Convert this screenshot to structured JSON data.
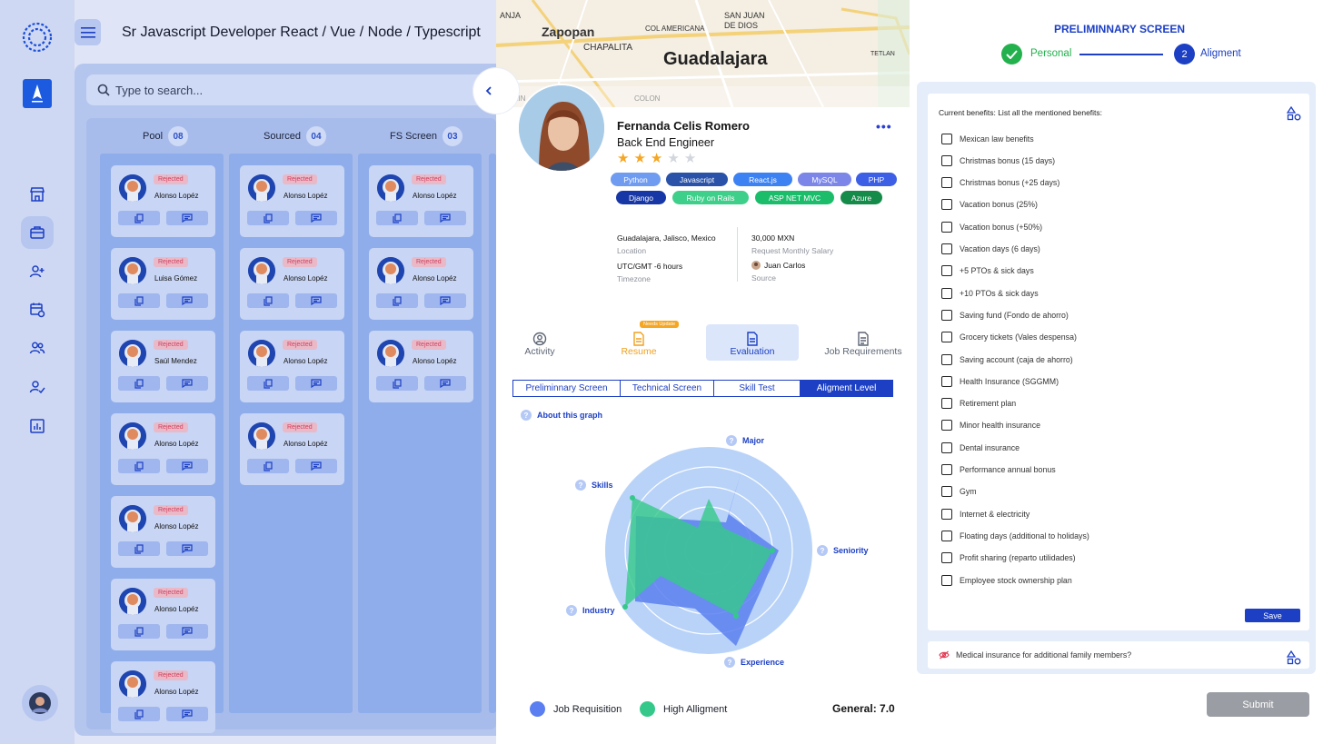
{
  "header": {
    "job_title": "Sr Javascript Developer React / Vue / Node / Typescript"
  },
  "sidebar": {
    "items": [
      {
        "icon": "store-icon",
        "label": ""
      },
      {
        "icon": "briefcase-icon",
        "label": "",
        "active": true
      },
      {
        "icon": "add-user-icon",
        "label": ""
      },
      {
        "icon": "calendar-clock-icon",
        "label": ""
      },
      {
        "icon": "team-icon",
        "label": ""
      },
      {
        "icon": "user-check-icon",
        "label": ""
      },
      {
        "icon": "chart-icon",
        "label": ""
      }
    ]
  },
  "search": {
    "placeholder": "Type to search..."
  },
  "lanes": [
    {
      "name": "Pool",
      "count": "08"
    },
    {
      "name": "Sourced",
      "count": "04"
    },
    {
      "name": "FS Screen",
      "count": "03"
    }
  ],
  "cards": {
    "badge": "Rejected",
    "pool": [
      "Alonso Lopéz",
      "Luisa Gómez",
      "Saúl Mendez",
      "Alonso Lopéz",
      "Alonso Lopéz",
      "Alonso Lopéz",
      "Alonso Lopéz"
    ],
    "sourced": [
      "Alonso Lopéz",
      "Alonso Lopéz",
      "Alonso Lopéz",
      "Alonso Lopéz"
    ],
    "fs": [
      "Alonso Lopéz",
      "Alonso Lopéz",
      "Alonso Lopéz"
    ]
  },
  "map": {
    "city": "Guadalajara",
    "labels": [
      "Zapopan",
      "CHAPALITA",
      "COL AMERICANA",
      "SAN JUAN",
      "DE DIOS",
      "TETLAN",
      "ANJA",
      "COLIN",
      "COLON"
    ]
  },
  "candidate": {
    "name": "Fernanda Celis Romero",
    "role": "Back End Engineer",
    "rating": 3,
    "rating_max": 5,
    "stars": "★★★★★",
    "more": "•••",
    "tags": [
      {
        "label": "Python",
        "color": "#6f9bf0"
      },
      {
        "label": "Javascript",
        "color": "#2952a8"
      },
      {
        "label": "React.js",
        "color": "#3d82f2"
      },
      {
        "label": "MySQL",
        "color": "#7b86e8"
      },
      {
        "label": "PHP",
        "color": "#3c5fe6"
      },
      {
        "label": "Django",
        "color": "#1737a6"
      },
      {
        "label": "Ruby on Rails",
        "color": "#3ecf8a"
      },
      {
        "label": "ASP NET MVC",
        "color": "#1bbd6b"
      },
      {
        "label": "Azure",
        "color": "#158b4a"
      }
    ],
    "location": {
      "value": "Guadalajara, Jalisco, Mexico",
      "label": "Location"
    },
    "timezone": {
      "value": "UTC/GMT -6 hours",
      "label": "Timezone"
    },
    "salary": {
      "value": "30,000 MXN",
      "label": "Request Monthly Salary"
    },
    "source": {
      "value": "Juan Carlos",
      "label": "Source"
    }
  },
  "tabs": [
    {
      "label": "Activity",
      "icon": "activity-icon"
    },
    {
      "label": "Resume",
      "icon": "resume-icon",
      "badge": "Needs Update"
    },
    {
      "label": "Evaluation",
      "icon": "evaluation-icon",
      "active": true
    },
    {
      "label": "Job Requirements",
      "icon": "requirements-icon"
    }
  ],
  "subtabs": [
    "Preliminnary Screen",
    "Technical Screen",
    "Skill Test",
    "Aligment Level"
  ],
  "about_graph": "About this graph",
  "radar": {
    "axes": [
      "Major",
      "Seniority",
      "Experience",
      "Industry",
      "Skills"
    ],
    "series": [
      {
        "name": "Job Requisition",
        "color": "#5b7ff0"
      },
      {
        "name": "High Alligment",
        "color": "#34c98a"
      }
    ]
  },
  "general": "General: 7.0",
  "right": {
    "title": "PRELIMINNARY SCREEN",
    "steps": [
      {
        "num": "",
        "label": "Personal",
        "done": true
      },
      {
        "num": "2",
        "label": "Aligment",
        "done": false
      }
    ],
    "question": "Current benefits: List all the mentioned benefits:",
    "benefits": [
      "Mexican law benefits",
      " Christmas bonus (15 days)",
      "Christmas bonus (+25 days)",
      "Vacation bonus (25%)",
      "Vacation bonus (+50%)",
      "Vacation days (6 days)",
      "+5 PTOs & sick days",
      "+10 PTOs & sick days",
      "Saving fund (Fondo de ahorro)",
      "Grocery tickets (Vales despensa)",
      "Saving account (caja de ahorro)",
      "Health Insurance (SGGMM)",
      "Retirement plan",
      "Minor health insurance",
      "Dental insurance",
      "Performance annual bonus",
      "Gym",
      "Internet & electricity",
      "Floating days (additional to holidays)",
      "Profit sharing (reparto utilidades)",
      "Employee stock ownership plan"
    ],
    "save": "Save",
    "question2": "Medical insurance for additional family members?",
    "submit": "Submit"
  }
}
